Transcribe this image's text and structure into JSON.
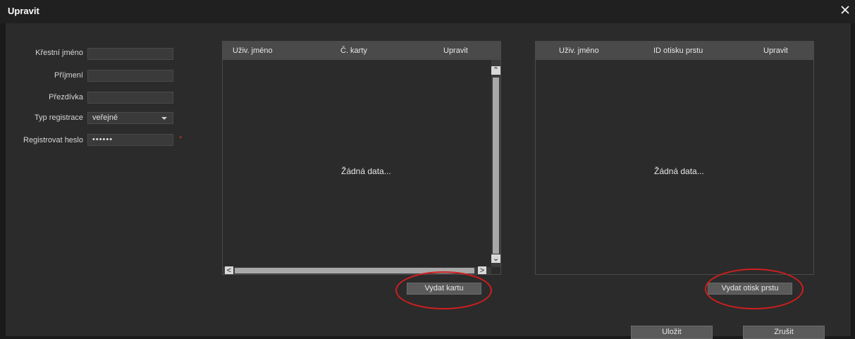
{
  "dialog": {
    "title": "Upravit",
    "close_glyph": "✕"
  },
  "form": {
    "first_name": {
      "label": "Křestní jméno",
      "value": ""
    },
    "last_name": {
      "label": "Příjmení",
      "value": ""
    },
    "nickname": {
      "label": "Přezdívka",
      "value": ""
    },
    "registration_type": {
      "label": "Typ registrace",
      "value": "veřejné"
    },
    "register_password": {
      "label": "Registrovat heslo",
      "value": "••••••",
      "required_mark": "*"
    }
  },
  "cards_table": {
    "columns": [
      "Uživ. jméno",
      "Č. karty",
      "Upravit"
    ],
    "empty_text": "Žádná data...",
    "scroll_up": "⌃",
    "scroll_down": "⌄",
    "scroll_left": "<",
    "scroll_right": ">"
  },
  "fingerprint_table": {
    "columns": [
      "Uživ. jméno",
      "ID otisku prstu",
      "Upravit"
    ],
    "empty_text": "Žádná data..."
  },
  "buttons": {
    "issue_card": "Vydat kartu",
    "issue_fingerprint": "Vydat otisk prstu",
    "save": "Uložit",
    "cancel": "Zrušit"
  },
  "colors": {
    "background": "#2b2b2b",
    "titlebar": "#202020",
    "table_header": "#4a4a4a",
    "button": "#5a5a5a",
    "highlight_ellipse": "#d21e1e",
    "required": "#c0392b"
  },
  "icons": {
    "close": "close-icon",
    "select_arrow": "chevron-down-icon"
  }
}
